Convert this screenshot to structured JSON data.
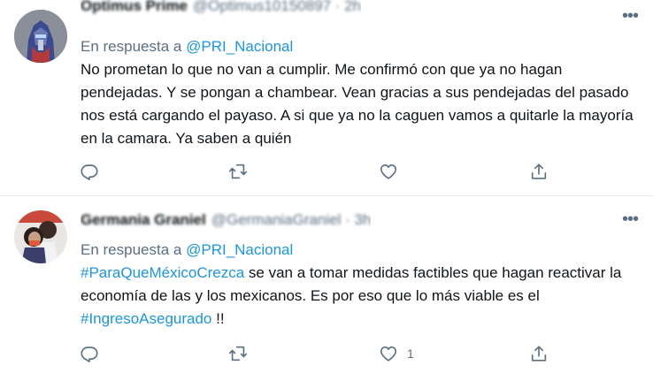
{
  "tweets": [
    {
      "author_name": "Optimus Prime",
      "author_handle": "@Optimus10150897 · 2h",
      "reply_prefix": "En respuesta a",
      "reply_to": "@PRI_Nacional",
      "text": "No prometan lo que no van a cumplir. Me confirmó con que ya no hagan pendejadas. Y se pongan a chambear. Vean gracias a sus pendejadas del pasado nos está cargando el payaso. A si que ya no la caguen vamos a quitarle la mayoría en la camara. Ya saben a quién",
      "like_count": ""
    },
    {
      "author_name": "Germania Graniel",
      "author_handle": "@GermaniaGraniel · 3h",
      "reply_prefix": "En respuesta a",
      "reply_to": "@PRI_Nacional",
      "hashtag1": "#ParaQueMéxicoCrezca",
      "text_mid": " se van a tomar medidas factibles que hagan reactivar la economía de las y los mexicanos. Es por eso que lo más viable es el ",
      "hashtag2": "#IngresoAsegurado",
      "text_end": " !!",
      "like_count": "1"
    }
  ],
  "icons": {
    "more": "more-horizontal-icon",
    "reply": "reply-icon",
    "retweet": "retweet-icon",
    "like": "heart-icon",
    "share": "share-icon"
  },
  "colors": {
    "link": "#1b95e0",
    "secondary": "#5b7083",
    "text": "#0f1419",
    "divider": "#e6ecf0"
  }
}
